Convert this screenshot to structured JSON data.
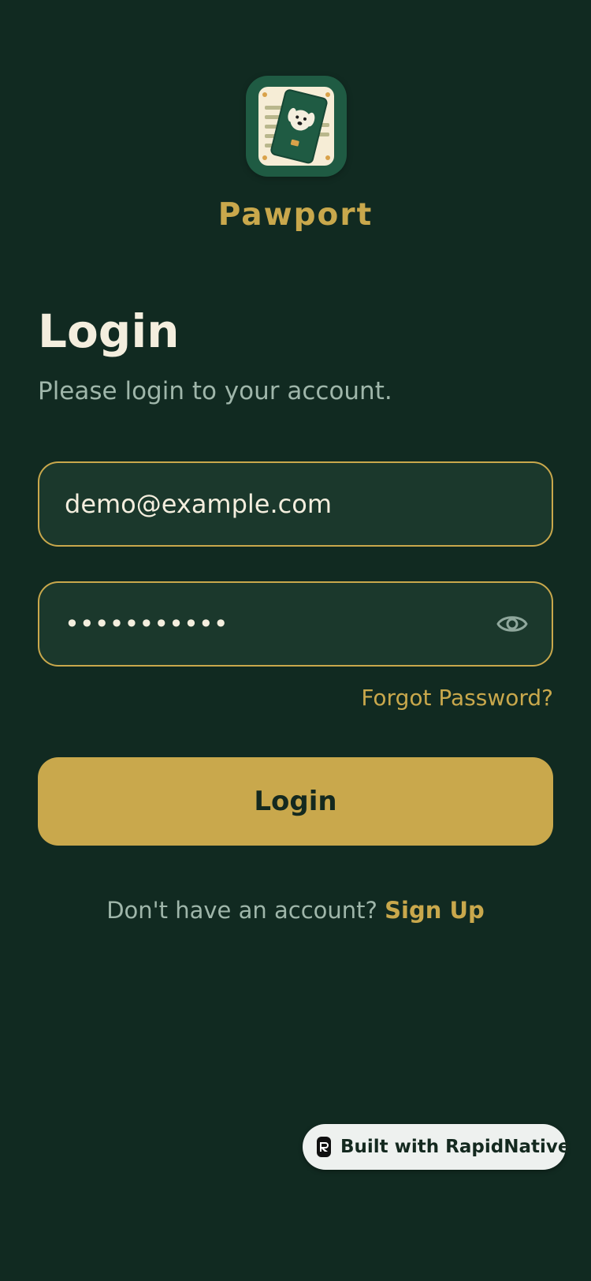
{
  "app": {
    "name": "Pawport",
    "logo_icon": "pet-passport-icon"
  },
  "login": {
    "title": "Login",
    "subtitle": "Please login to your account.",
    "email_value": "demo@example.com",
    "password_value": "•••••••••••",
    "show_password_icon": "eye-icon",
    "forgot_password_label": "Forgot Password?",
    "submit_label": "Login",
    "no_account_text": "Don't have an account?",
    "signup_label": "Sign Up"
  },
  "badge": {
    "label": "Built with RapidNative",
    "icon": "rapidnative-logo-icon"
  },
  "colors": {
    "background": "#112a21",
    "accent": "#c9a84c",
    "field_background": "#1b382c",
    "text_primary": "#f4eede",
    "text_muted": "#9fb6aa"
  }
}
